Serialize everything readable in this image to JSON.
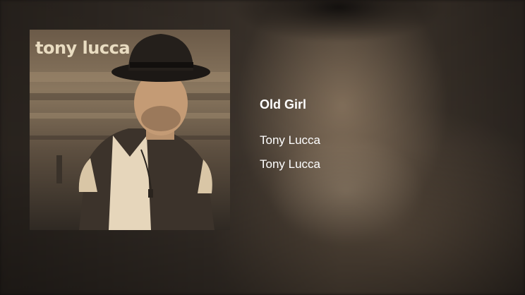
{
  "cover": {
    "artist_text": "tony lucca"
  },
  "track": {
    "title": "Old Girl",
    "artist": "Tony Lucca",
    "album": "Tony Lucca"
  }
}
